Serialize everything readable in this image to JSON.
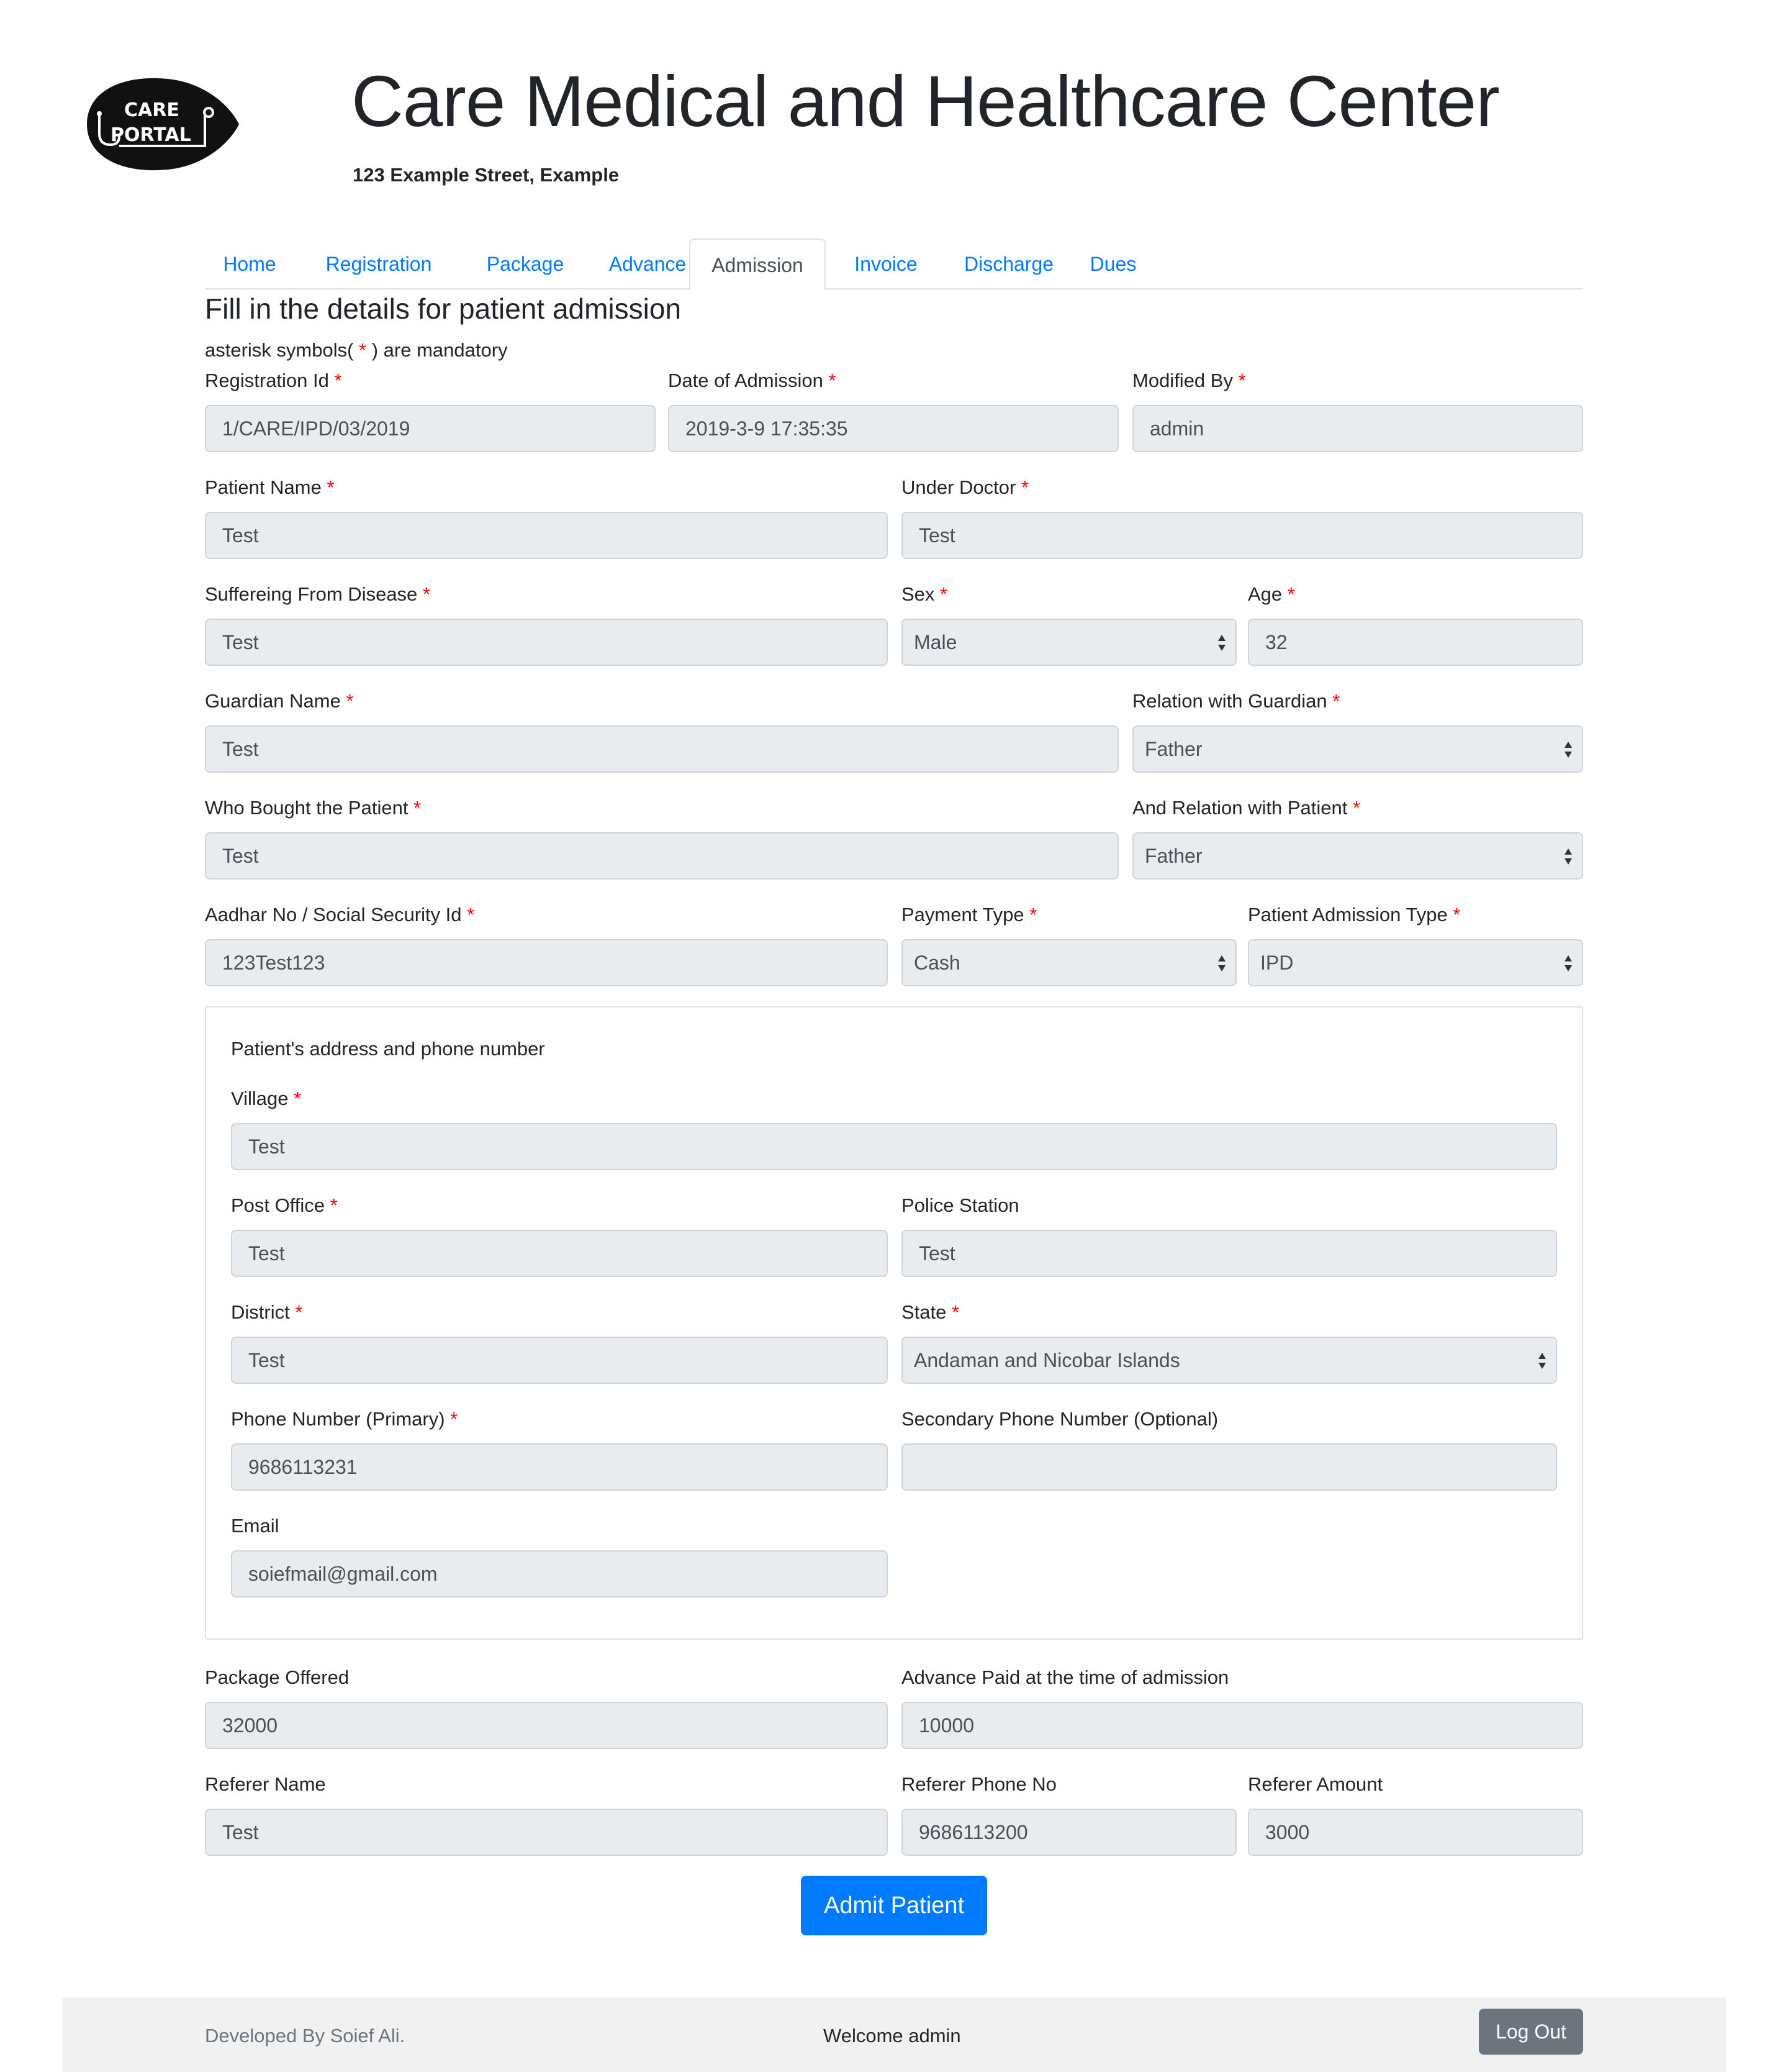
{
  "brand": {
    "logo_line1": "CARE",
    "logo_line2": "PORTAL",
    "title": "Care Medical and Healthcare Center",
    "address": "123 Example Street, Example"
  },
  "tabs": [
    {
      "label": "Home",
      "active": false
    },
    {
      "label": "Registration",
      "active": false
    },
    {
      "label": "Package",
      "active": false
    },
    {
      "label": "Advance",
      "active": false
    },
    {
      "label": "Admission",
      "active": true
    },
    {
      "label": "Invoice",
      "active": false
    },
    {
      "label": "Discharge",
      "active": false
    },
    {
      "label": "Dues",
      "active": false
    }
  ],
  "form": {
    "heading": "Fill in the details for patient admission",
    "note_prefix": "asterisk symbols( ",
    "note_star": "*",
    "note_suffix": " ) are mandatory",
    "required_mark": "*",
    "fields": {
      "registration_id": {
        "label": "Registration Id",
        "value": "1/CARE/IPD/03/2019"
      },
      "date_of_admission": {
        "label": "Date of Admission",
        "value": "2019-3-9 17:35:35"
      },
      "modified_by": {
        "label": "Modified By",
        "value": "admin"
      },
      "patient_name": {
        "label": "Patient Name",
        "value": "Test"
      },
      "under_doctor": {
        "label": "Under Doctor",
        "value": "Test"
      },
      "disease": {
        "label": "Suffereing From Disease",
        "value": "Test"
      },
      "sex": {
        "label": "Sex",
        "value": "Male"
      },
      "age": {
        "label": "Age",
        "value": "32"
      },
      "guardian_name": {
        "label": "Guardian Name",
        "value": "Test"
      },
      "guardian_relation": {
        "label": "Relation with Guardian",
        "value": "Father"
      },
      "who_bought": {
        "label": "Who Bought the Patient",
        "value": "Test"
      },
      "bought_relation": {
        "label": "And Relation with Patient",
        "value": "Father"
      },
      "aadhar": {
        "label": "Aadhar No / Social Security Id",
        "value": "123Test123"
      },
      "payment_type": {
        "label": "Payment Type",
        "value": "Cash"
      },
      "admission_type": {
        "label": "Patient Admission Type",
        "value": "IPD"
      }
    },
    "address": {
      "title": "Patient's address and phone number",
      "village": {
        "label": "Village",
        "value": "Test"
      },
      "post_office": {
        "label": "Post Office",
        "value": "Test"
      },
      "police_station": {
        "label": "Police Station",
        "value": "Test"
      },
      "district": {
        "label": "District",
        "value": "Test"
      },
      "state": {
        "label": "State",
        "value": "Andaman and Nicobar Islands"
      },
      "phone_primary": {
        "label": "Phone Number (Primary)",
        "value": "9686113231"
      },
      "phone_secondary": {
        "label": "Secondary Phone Number (Optional)",
        "value": ""
      },
      "email": {
        "label": "Email",
        "value": "soiefmail@gmail.com"
      }
    },
    "package_offered": {
      "label": "Package Offered",
      "value": "32000"
    },
    "advance_paid": {
      "label": "Advance Paid at the time of admission",
      "value": "10000"
    },
    "referer_name": {
      "label": "Referer Name",
      "value": "Test"
    },
    "referer_phone": {
      "label": "Referer Phone No",
      "value": "9686113200"
    },
    "referer_amount": {
      "label": "Referer Amount",
      "value": "3000"
    },
    "submit_label": "Admit Patient"
  },
  "footer": {
    "developer": "Developed By Soief Ali.",
    "welcome": "Welcome admin",
    "logout_label": "Log Out"
  },
  "colors": {
    "accent": "#007bff",
    "required": "#ff0000",
    "input_bg": "#e9ecef",
    "logout_bg": "#6c757d"
  }
}
